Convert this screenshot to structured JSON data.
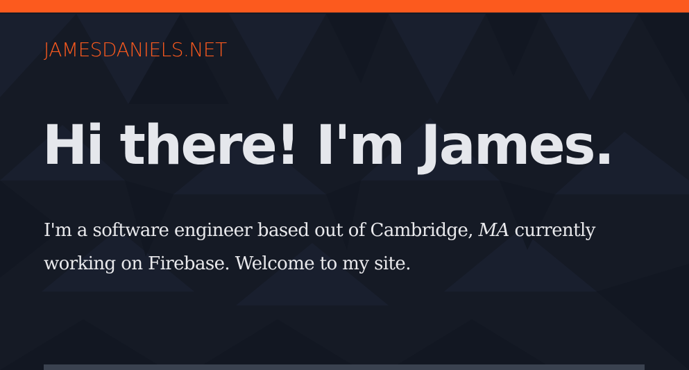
{
  "colors": {
    "background": "#151a25",
    "accent": "#fc5a1e",
    "heading": "#e5e7ec",
    "body_text": "#e9e9ec",
    "panel": "#3a4250"
  },
  "header": {
    "site_name": "JAMESDANIELS.NET"
  },
  "hero": {
    "title": "Hi there! I'm James.",
    "intro_before": "I'm a software engineer based out of Cambridge, ",
    "intro_emphasis": "MA",
    "intro_after": " currently working on Firebase. Welcome to my site."
  }
}
